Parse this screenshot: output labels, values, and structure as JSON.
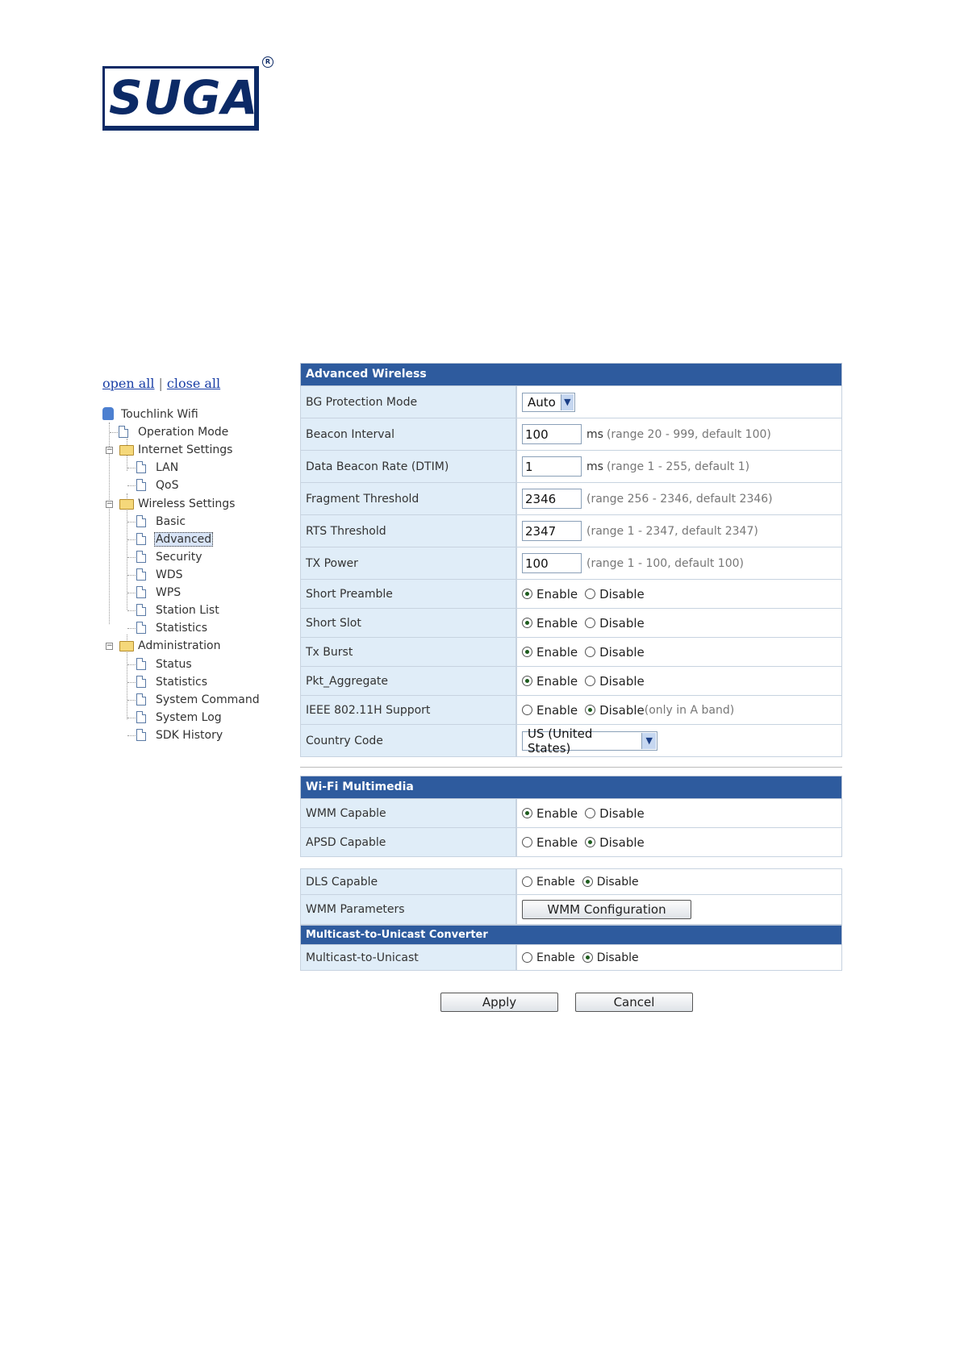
{
  "logo": {
    "text": "SUGA",
    "mark": "R"
  },
  "tree_links": {
    "open_all": "open all",
    "separator": "|",
    "close_all": "close all"
  },
  "tree": {
    "root": "Touchlink Wifi",
    "items": [
      {
        "label": "Operation Mode"
      },
      {
        "label": "Internet Settings"
      },
      {
        "label": "LAN"
      },
      {
        "label": "QoS"
      },
      {
        "label": "Wireless Settings"
      },
      {
        "label": "Basic"
      },
      {
        "label": "Advanced",
        "selected": true
      },
      {
        "label": "Security"
      },
      {
        "label": "WDS"
      },
      {
        "label": "WPS"
      },
      {
        "label": "Station List"
      },
      {
        "label": "Statistics"
      },
      {
        "label": "Administration"
      },
      {
        "label": "Status"
      },
      {
        "label": "Statistics"
      },
      {
        "label": "System Command"
      },
      {
        "label": "System Log"
      },
      {
        "label": "SDK History"
      }
    ]
  },
  "advanced": {
    "header": "Advanced Wireless",
    "bg_protection": {
      "label": "BG Protection Mode",
      "value": "Auto"
    },
    "beacon_interval": {
      "label": "Beacon Interval",
      "value": "100",
      "unit": "ms",
      "hint": "(range 20 - 999, default 100)"
    },
    "dtim": {
      "label": "Data Beacon Rate (DTIM)",
      "value": "1",
      "unit": "ms",
      "hint": "(range 1 - 255, default 1)"
    },
    "fragment": {
      "label": "Fragment Threshold",
      "value": "2346",
      "hint": "(range 256 - 2346, default 2346)"
    },
    "rts": {
      "label": "RTS Threshold",
      "value": "2347",
      "hint": "(range 1 - 2347, default 2347)"
    },
    "tx_power": {
      "label": "TX Power",
      "value": "100",
      "hint": "(range 1 - 100, default 100)"
    },
    "short_preamble": {
      "label": "Short Preamble",
      "selected": "Enable"
    },
    "short_slot": {
      "label": "Short Slot",
      "selected": "Enable"
    },
    "tx_burst": {
      "label": "Tx Burst",
      "selected": "Enable"
    },
    "pkt_aggregate": {
      "label": "Pkt_Aggregate",
      "selected": "Enable"
    },
    "ieee80211h": {
      "label": "IEEE 802.11H Support",
      "selected": "Disable",
      "note": "(only in A band)"
    },
    "country": {
      "label": "Country Code",
      "value": "US (United States)"
    }
  },
  "radio": {
    "enable": "Enable",
    "disable": "Disable"
  },
  "wmm": {
    "header": "Wi-Fi Multimedia",
    "wmm_capable": {
      "label": "WMM Capable",
      "selected": "Enable"
    },
    "apsd_capable": {
      "label": "APSD Capable",
      "selected": "Disable"
    },
    "dls_capable": {
      "label": "DLS Capable",
      "selected": "Disable"
    },
    "wmm_params": {
      "label": "WMM Parameters",
      "button": "WMM Configuration"
    }
  },
  "m2u": {
    "header": "Multicast-to-Unicast Converter",
    "row": {
      "label": "Multicast-to-Unicast",
      "selected": "Disable"
    }
  },
  "buttons": {
    "apply": "Apply",
    "cancel": "Cancel"
  }
}
